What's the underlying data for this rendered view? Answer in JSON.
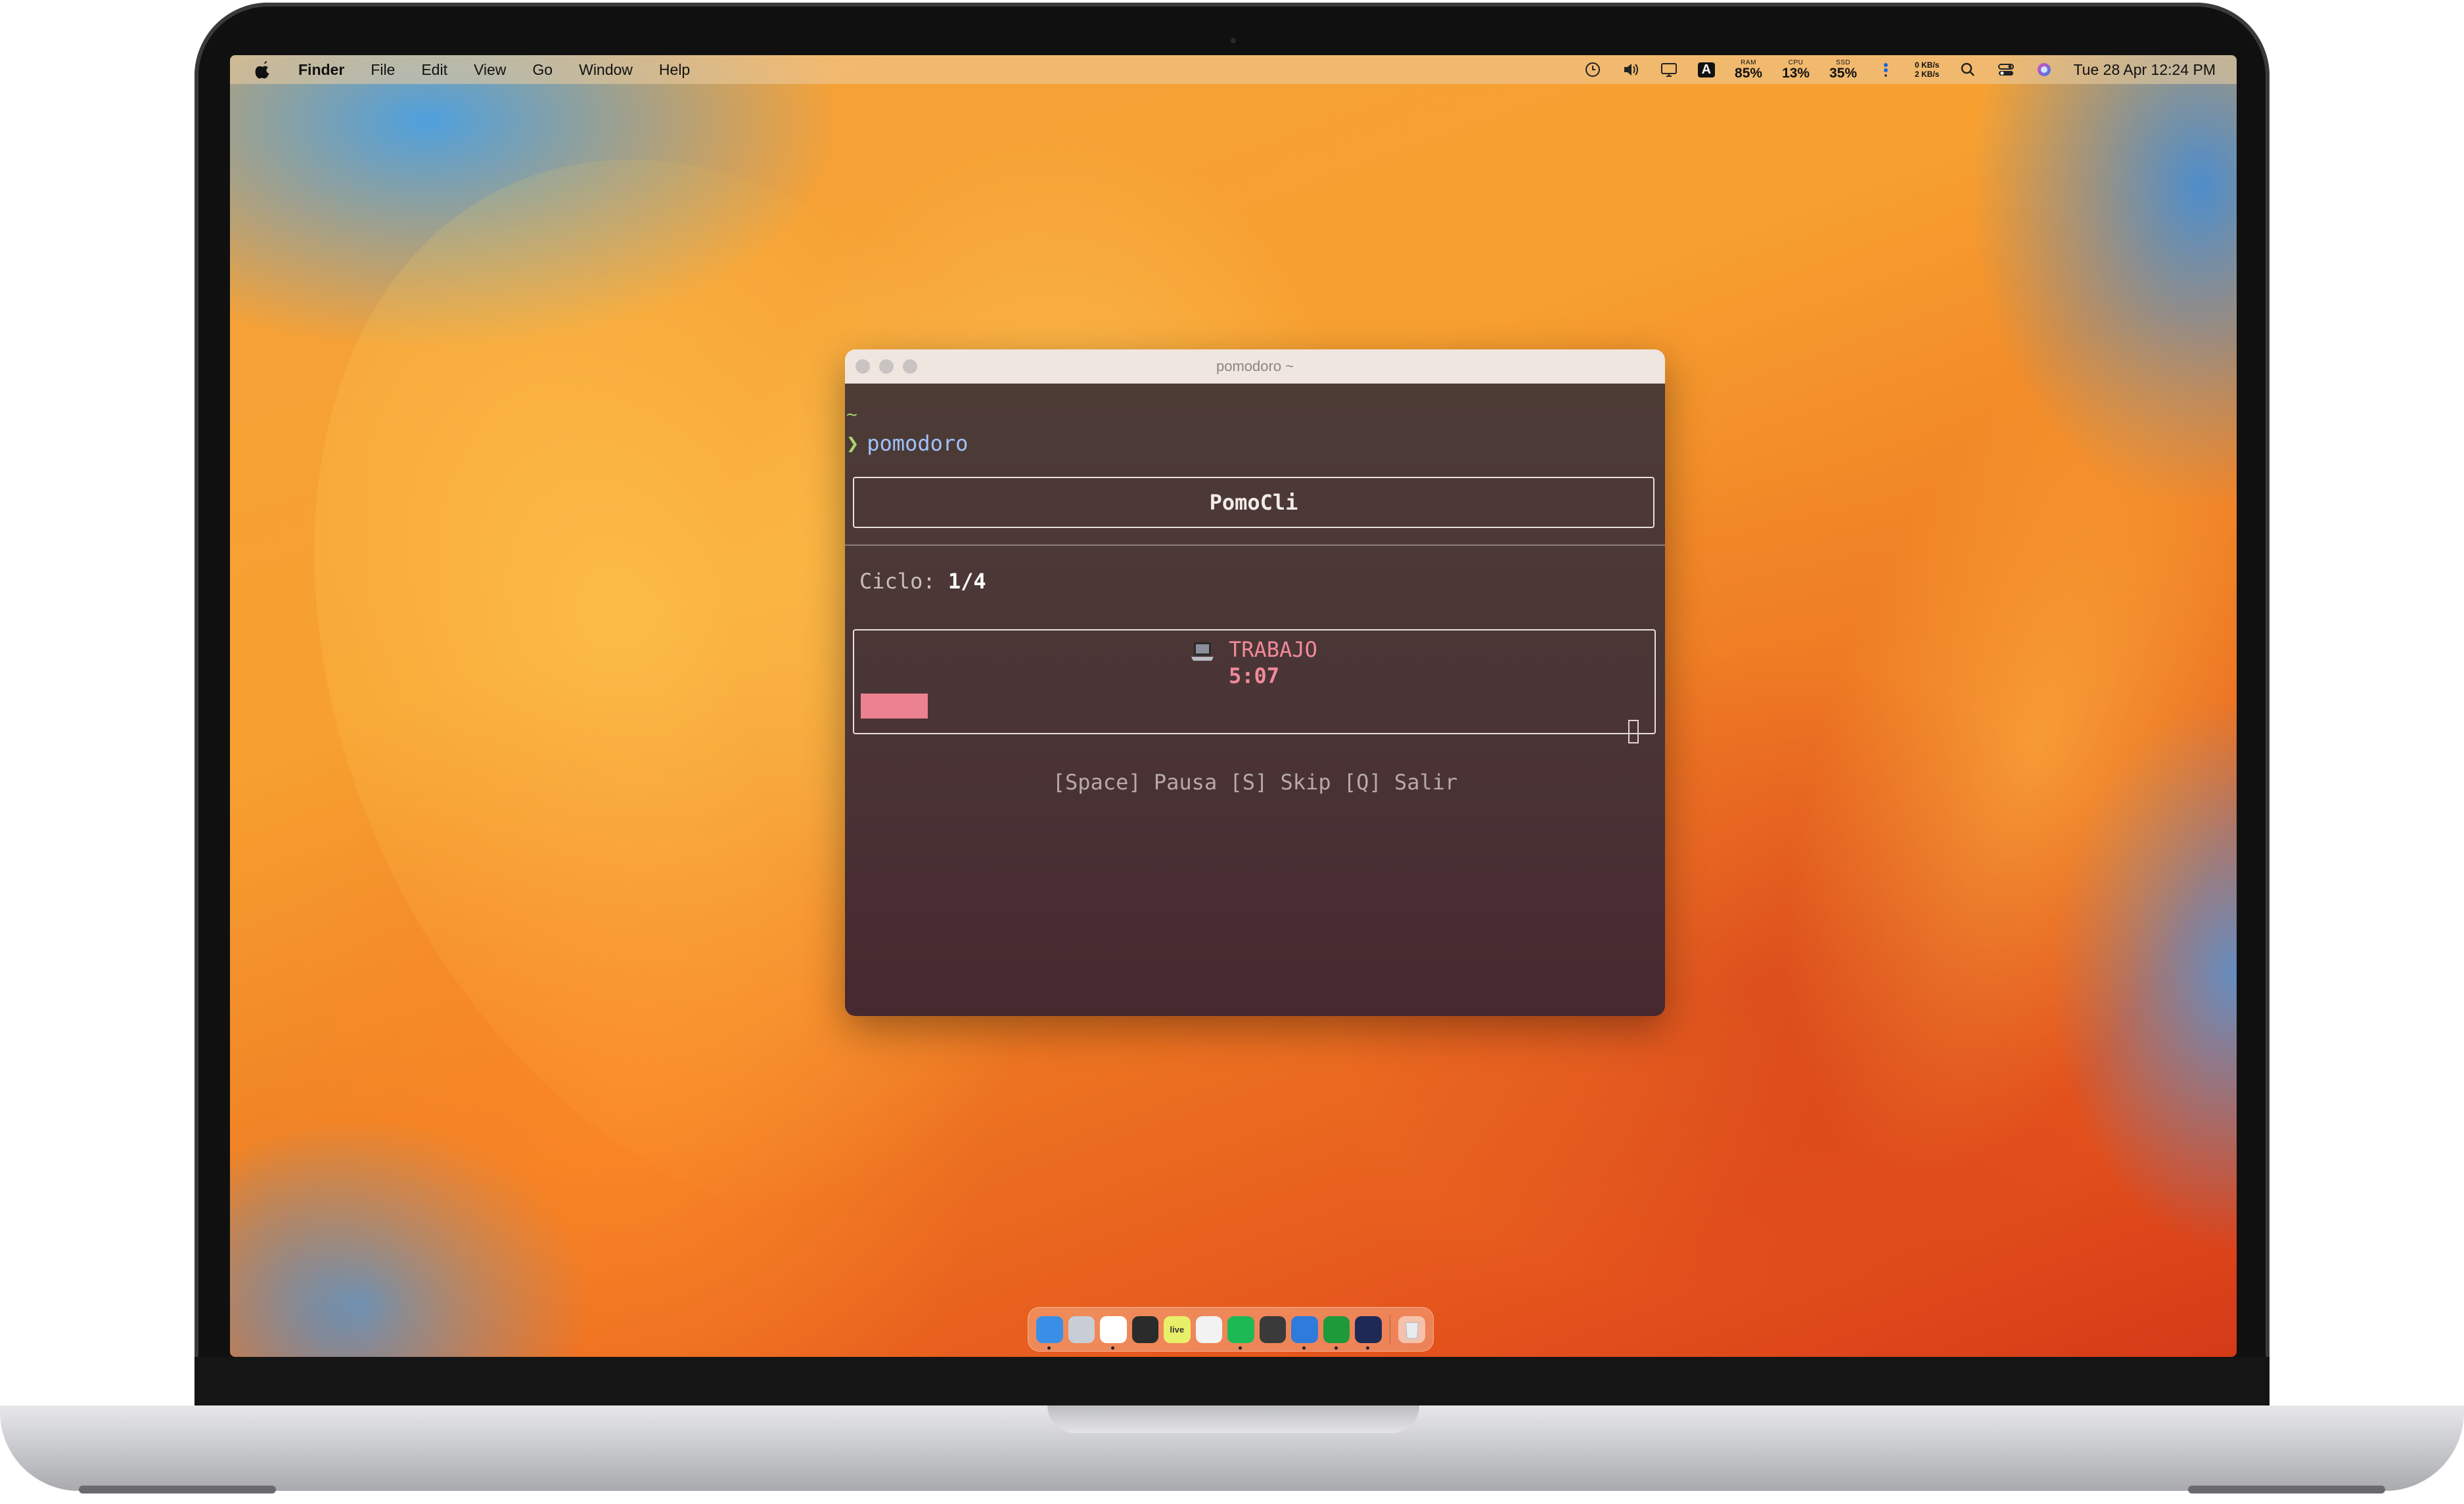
{
  "menubar": {
    "app_name": "Finder",
    "items": [
      "File",
      "Edit",
      "View",
      "Go",
      "Window",
      "Help"
    ],
    "stats": {
      "ram_label": "RAM",
      "ram_value": "85%",
      "cpu_label": "CPU",
      "cpu_value": "13%",
      "ssd_label": "SSD",
      "ssd_value": "35%"
    },
    "network": {
      "up": "0 KB/s",
      "down": "2 KB/s"
    },
    "keyboard_indicator": "A",
    "clock": "Tue 28 Apr  12:24 PM"
  },
  "terminal": {
    "title": "pomodoro ~",
    "tilde": "~",
    "prompt_symbol": "❯",
    "command": "pomodoro",
    "app_header": "PomoCli",
    "cycle_label": "Ciclo:",
    "cycle_value": "1/4",
    "phase": "TRABAJO",
    "time_remaining": "5:07",
    "progress_fraction": 0.085,
    "progress_color": "#ec8190",
    "key_hints": "[Space] Pausa [S] Skip [Q] Salir"
  },
  "dock": {
    "apps": [
      {
        "icon": "finder-icon",
        "color": "#3a8ee6",
        "running": true
      },
      {
        "icon": "launchpad-icon",
        "color": "#c9cdd6",
        "running": false
      },
      {
        "icon": "freeform-icon",
        "color": "#ffffff",
        "running": true
      },
      {
        "icon": "notes-editor-icon",
        "color": "#2b2b2b",
        "running": false
      },
      {
        "icon": "live-icon",
        "color": "#e8f06a",
        "running": false,
        "text": "live"
      },
      {
        "icon": "pastebot-icon",
        "color": "#f2f2f2",
        "running": false
      },
      {
        "icon": "spotify-icon",
        "color": "#1db954",
        "running": true
      },
      {
        "icon": "shortcuts-icon",
        "color": "#3a3a3a",
        "running": false
      },
      {
        "icon": "pencil-app-icon",
        "color": "#2f7bdc",
        "running": true
      },
      {
        "icon": "green-a-icon",
        "color": "#1f9a3a",
        "running": true
      },
      {
        "icon": "xcode-instruments-icon",
        "color": "#1e2a55",
        "running": true
      }
    ],
    "trash_icon": "trash-icon"
  }
}
